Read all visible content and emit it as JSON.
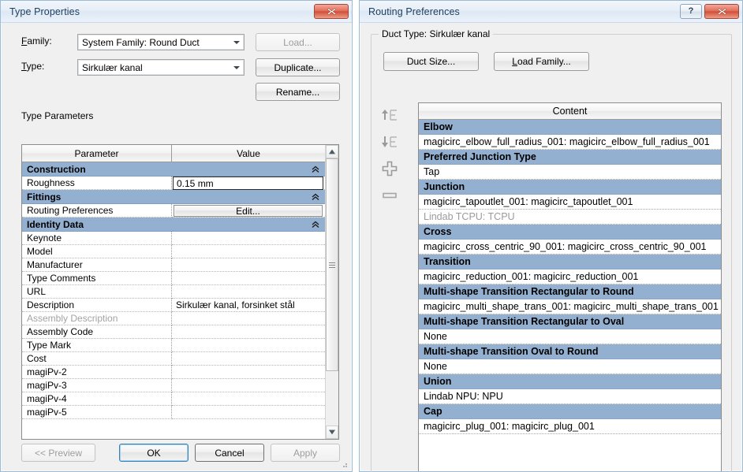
{
  "type_properties": {
    "title": "Type Properties",
    "close_label": "x",
    "family_label": "Family:",
    "family_value": "System Family: Round Duct",
    "type_label": "Type:",
    "type_value": "Sirkulær kanal",
    "load_label": "Load...",
    "duplicate_label": "Duplicate...",
    "rename_label": "Rename...",
    "section_label": "Type Parameters",
    "columns": [
      "Parameter",
      "Value"
    ],
    "rows": [
      {
        "kind": "section",
        "parameter": "Construction",
        "value": ""
      },
      {
        "kind": "input",
        "parameter": "Roughness",
        "value": "0.15 mm"
      },
      {
        "kind": "section",
        "parameter": "Fittings",
        "value": ""
      },
      {
        "kind": "button",
        "parameter": "Routing Preferences",
        "value": "Edit..."
      },
      {
        "kind": "section",
        "parameter": "Identity Data",
        "value": ""
      },
      {
        "kind": "row",
        "parameter": "Keynote",
        "value": ""
      },
      {
        "kind": "row",
        "parameter": "Model",
        "value": ""
      },
      {
        "kind": "row",
        "parameter": "Manufacturer",
        "value": ""
      },
      {
        "kind": "row",
        "parameter": "Type Comments",
        "value": ""
      },
      {
        "kind": "row",
        "parameter": "URL",
        "value": ""
      },
      {
        "kind": "row",
        "parameter": "Description",
        "value": "Sirkulær kanal, forsinket stål"
      },
      {
        "kind": "disabled",
        "parameter": "Assembly Description",
        "value": ""
      },
      {
        "kind": "row",
        "parameter": "Assembly Code",
        "value": ""
      },
      {
        "kind": "row",
        "parameter": "Type Mark",
        "value": ""
      },
      {
        "kind": "row",
        "parameter": "Cost",
        "value": ""
      },
      {
        "kind": "row",
        "parameter": "magiPv-2",
        "value": ""
      },
      {
        "kind": "row",
        "parameter": "magiPv-3",
        "value": ""
      },
      {
        "kind": "row",
        "parameter": "magiPv-4",
        "value": ""
      },
      {
        "kind": "row",
        "parameter": "magiPv-5",
        "value": ""
      }
    ],
    "buttons": {
      "preview": "<< Preview",
      "ok": "OK",
      "cancel": "Cancel",
      "apply": "Apply"
    }
  },
  "routing_preferences": {
    "title": "Routing Preferences",
    "help_label": "?",
    "close_label": "x",
    "group_title": "Duct Type: Sirkulær kanal",
    "duct_size_label": "Duct Size...",
    "load_family_label": "Load Family...",
    "content_header": "Content",
    "tools": [
      "move-up-icon",
      "move-down-icon",
      "add-row-icon",
      "remove-row-icon"
    ],
    "rows": [
      {
        "kind": "section",
        "text": "Elbow"
      },
      {
        "kind": "item",
        "text": "magicirc_elbow_full_radius_001: magicirc_elbow_full_radius_001"
      },
      {
        "kind": "section",
        "text": "Preferred Junction Type"
      },
      {
        "kind": "item",
        "text": "Tap"
      },
      {
        "kind": "section",
        "text": "Junction"
      },
      {
        "kind": "item",
        "text": "magicirc_tapoutlet_001: magicirc_tapoutlet_001"
      },
      {
        "kind": "muted",
        "text": "Lindab TCPU: TCPU"
      },
      {
        "kind": "section",
        "text": "Cross"
      },
      {
        "kind": "item",
        "text": "magicirc_cross_centric_90_001: magicirc_cross_centric_90_001"
      },
      {
        "kind": "section",
        "text": "Transition"
      },
      {
        "kind": "item",
        "text": "magicirc_reduction_001: magicirc_reduction_001"
      },
      {
        "kind": "section",
        "text": "Multi-shape Transition Rectangular to Round"
      },
      {
        "kind": "item",
        "text": "magicirc_multi_shape_trans_001: magicirc_multi_shape_trans_001"
      },
      {
        "kind": "section",
        "text": "Multi-shape Transition Rectangular to Oval"
      },
      {
        "kind": "item",
        "text": "None"
      },
      {
        "kind": "section",
        "text": "Multi-shape Transition Oval to Round"
      },
      {
        "kind": "item",
        "text": "None"
      },
      {
        "kind": "section",
        "text": "Union"
      },
      {
        "kind": "item",
        "text": "Lindab NPU: NPU"
      },
      {
        "kind": "section",
        "text": "Cap"
      },
      {
        "kind": "item",
        "text": "magicirc_plug_001: magicirc_plug_001"
      }
    ]
  },
  "colors": {
    "section_band": "#94b0d0",
    "titlebar_text": "#1c3d5c",
    "close_red": "#d04f37",
    "dialog_bg": "#f0f0f0",
    "default_button_border": "#3c7fb1"
  }
}
